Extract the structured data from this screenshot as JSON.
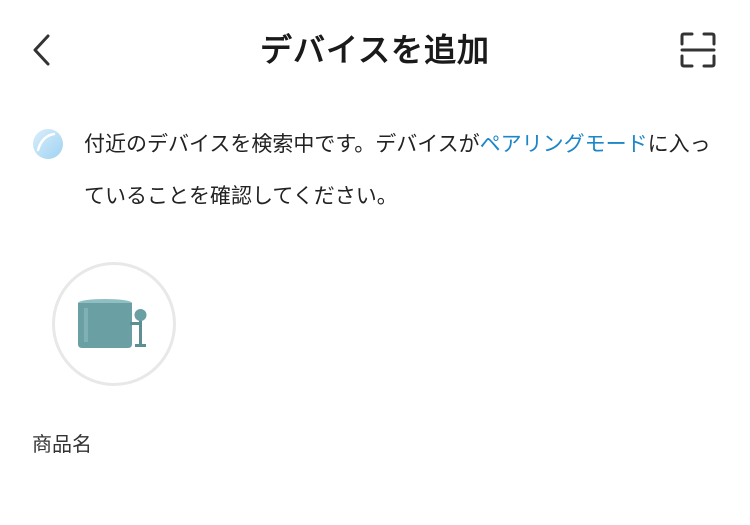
{
  "header": {
    "title": "デバイスを追加",
    "back_icon": "chevron-left-icon",
    "scan_icon": "scan-frame-icon"
  },
  "notice": {
    "icon": "spinner-icon",
    "text_before": "付近のデバイスを検索中です。デバイスが",
    "link_text": "ペアリングモード",
    "text_after": "に入っていることを確認してください。"
  },
  "device": {
    "name": "商品名",
    "image": "product-image"
  },
  "colors": {
    "text": "#222222",
    "link": "#1c86c9",
    "icon": "#333333",
    "product": "#6a9fa4",
    "circle_border": "#e8e8e8"
  }
}
